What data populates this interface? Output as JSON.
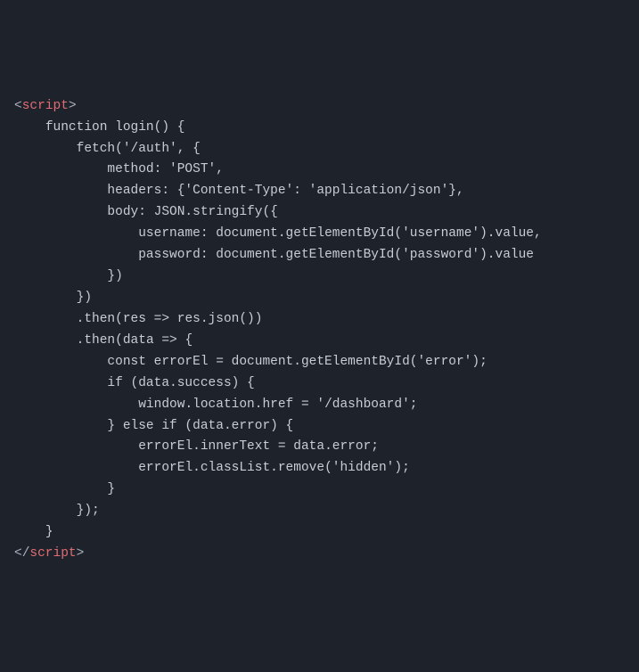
{
  "code": {
    "lines": [
      {
        "indent": 0,
        "segments": [
          {
            "t": "bracket",
            "v": "<"
          },
          {
            "t": "tag",
            "v": "script"
          },
          {
            "t": "bracket",
            "v": ">"
          }
        ]
      },
      {
        "indent": 1,
        "segments": [
          {
            "t": "keyword",
            "v": "function login() {"
          }
        ]
      },
      {
        "indent": 2,
        "segments": [
          {
            "t": "func",
            "v": "fetch('/auth', {"
          }
        ]
      },
      {
        "indent": 3,
        "segments": [
          {
            "t": "prop",
            "v": "method: 'POST',"
          }
        ]
      },
      {
        "indent": 3,
        "segments": [
          {
            "t": "prop",
            "v": "headers: {'Content-Type': 'application/json'},"
          }
        ]
      },
      {
        "indent": 3,
        "segments": [
          {
            "t": "prop",
            "v": "body: JSON.stringify({"
          }
        ]
      },
      {
        "indent": 4,
        "segments": [
          {
            "t": "prop",
            "v": "username: document.getElementById('username').value,"
          }
        ]
      },
      {
        "indent": 4,
        "segments": [
          {
            "t": "prop",
            "v": "password: document.getElementById('password').value"
          }
        ]
      },
      {
        "indent": 3,
        "segments": [
          {
            "t": "punct",
            "v": "})"
          }
        ]
      },
      {
        "indent": 2,
        "segments": [
          {
            "t": "punct",
            "v": "})"
          }
        ]
      },
      {
        "indent": 2,
        "segments": [
          {
            "t": "func",
            "v": ".then(res => res.json())"
          }
        ]
      },
      {
        "indent": 2,
        "segments": [
          {
            "t": "func",
            "v": ".then(data => {"
          }
        ]
      },
      {
        "indent": 3,
        "segments": [
          {
            "t": "keyword",
            "v": "const errorEl = document.getElementById('error');"
          }
        ]
      },
      {
        "indent": 3,
        "segments": [
          {
            "t": "keyword",
            "v": "if (data.success) {"
          }
        ]
      },
      {
        "indent": 4,
        "segments": [
          {
            "t": "prop",
            "v": "window.location.href = '/dashboard';"
          }
        ]
      },
      {
        "indent": 3,
        "segments": [
          {
            "t": "keyword",
            "v": "} else if (data.error) {"
          }
        ]
      },
      {
        "indent": 4,
        "segments": [
          {
            "t": "prop",
            "v": "errorEl.innerText = data.error;"
          }
        ]
      },
      {
        "indent": 4,
        "segments": [
          {
            "t": "prop",
            "v": "errorEl.classList.remove('hidden');"
          }
        ]
      },
      {
        "indent": 3,
        "segments": [
          {
            "t": "punct",
            "v": "}"
          }
        ]
      },
      {
        "indent": 2,
        "segments": [
          {
            "t": "punct",
            "v": "});"
          }
        ]
      },
      {
        "indent": 1,
        "segments": [
          {
            "t": "punct",
            "v": "}"
          }
        ]
      },
      {
        "indent": 0,
        "segments": [
          {
            "t": "bracket",
            "v": "</"
          },
          {
            "t": "tag",
            "v": "script"
          },
          {
            "t": "bracket",
            "v": ">"
          }
        ]
      }
    ]
  },
  "indent_unit": "    "
}
